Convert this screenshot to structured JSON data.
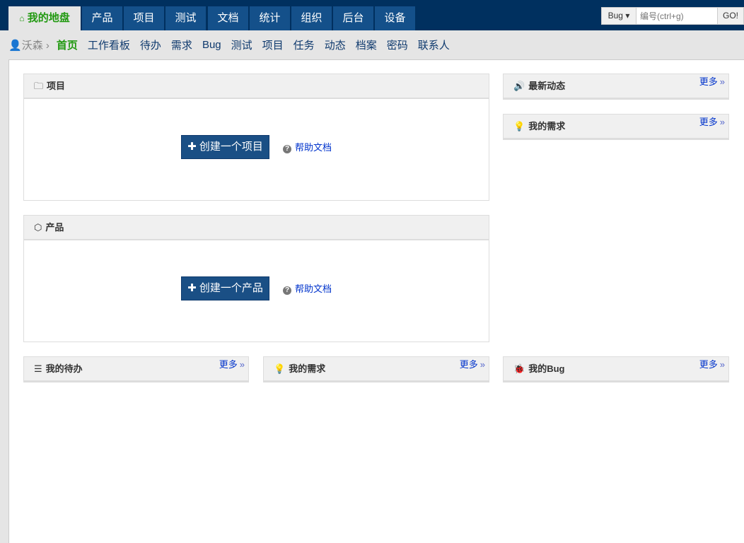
{
  "topnav": {
    "tabs": [
      {
        "label": "我的地盘",
        "active": true
      },
      {
        "label": "产品"
      },
      {
        "label": "项目"
      },
      {
        "label": "测试"
      },
      {
        "label": "文档"
      },
      {
        "label": "统计"
      },
      {
        "label": "组织"
      },
      {
        "label": "后台"
      },
      {
        "label": "设备"
      }
    ]
  },
  "search": {
    "type": "Bug",
    "placeholder": "编号(ctrl+g)",
    "go": "GO!"
  },
  "subnav": {
    "user": "沃森",
    "items": [
      "首页",
      "工作看板",
      "待办",
      "需求",
      "Bug",
      "测试",
      "项目",
      "任务",
      "动态",
      "档案",
      "密码",
      "联系人"
    ]
  },
  "panels": {
    "project": {
      "title": "项目",
      "button": "创建一个项目",
      "help": "帮助文档"
    },
    "product": {
      "title": "产品",
      "button": "创建一个产品",
      "help": "帮助文档"
    },
    "dynamic": {
      "title": "最新动态",
      "more": "更多"
    },
    "story_right": {
      "title": "我的需求",
      "more": "更多"
    },
    "todo": {
      "title": "我的待办",
      "more": "更多"
    },
    "story": {
      "title": "我的需求",
      "more": "更多"
    },
    "bug": {
      "title": "我的Bug",
      "more": "更多"
    }
  },
  "colors": {
    "topbar": "#00305f",
    "tab": "#14508a",
    "active": "#229911",
    "button": "#1a4f85"
  }
}
